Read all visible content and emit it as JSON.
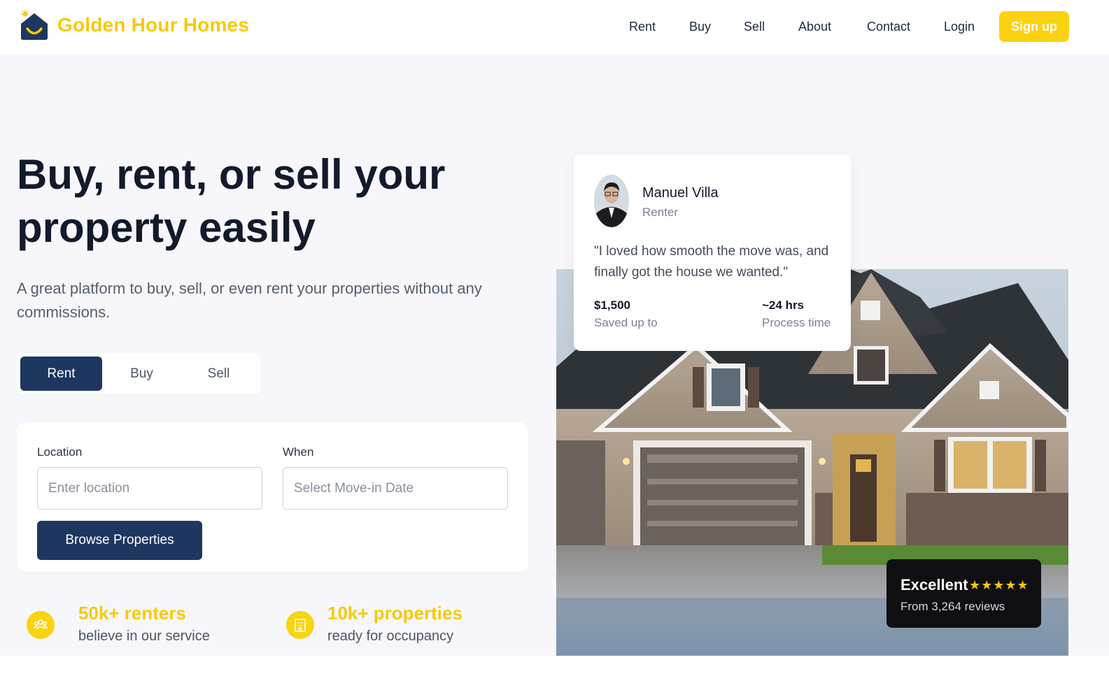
{
  "brand": {
    "name": "Golden Hour Homes",
    "logo_icon": "house-smile-icon",
    "accent": "#f7c90a",
    "navy": "#1e3760"
  },
  "nav": {
    "links": [
      "Rent",
      "Buy",
      "Sell",
      "About",
      "Contact",
      "Login"
    ],
    "signup_label": "Sign up"
  },
  "hero": {
    "title": "Buy, rent, or sell your property easily",
    "subtitle": "A great platform to buy, sell, or even rent your properties without any commissions.",
    "tabs": [
      "Rent",
      "Buy",
      "Sell"
    ],
    "active_tab": "Rent"
  },
  "search": {
    "location_label": "Location",
    "location_placeholder": "Enter location",
    "when_label": "When",
    "when_placeholder": "Select Move-in Date",
    "browse_label": "Browse Properties"
  },
  "stats": [
    {
      "value": "50k+ renters",
      "text": "believe in our service",
      "icon": "users-icon"
    },
    {
      "value": "10k+ properties",
      "text": "ready for occupancy",
      "icon": "building-icon"
    }
  ],
  "testimonial": {
    "name": "Manuel Villa",
    "role": "Renter",
    "quote": "\"I loved how smooth the move was, and finally got the house we wanted.\"",
    "metrics": [
      {
        "value": "$1,500",
        "caption": "Saved up to"
      },
      {
        "value": "~24 hrs",
        "caption": "Process time"
      }
    ]
  },
  "rating": {
    "title": "Excellent",
    "stars": "★★★★★",
    "reviews": "From 3,264 reviews"
  }
}
